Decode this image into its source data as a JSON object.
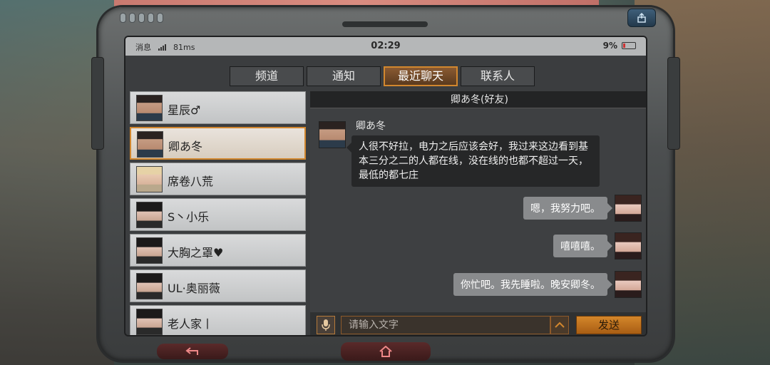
{
  "status_bar": {
    "messages_label": "消息",
    "ping": "81ms",
    "time": "02:29",
    "battery": "9%"
  },
  "tabs": [
    {
      "label": "频道",
      "active": false
    },
    {
      "label": "通知",
      "active": false
    },
    {
      "label": "最近聊天",
      "active": true
    },
    {
      "label": "联系人",
      "active": false
    }
  ],
  "contacts": [
    {
      "name": "星辰♂",
      "avatar": "male-avatar"
    },
    {
      "name": "卿あ冬",
      "avatar": "male-avatar",
      "selected": true
    },
    {
      "name": "席卷八荒",
      "avatar": "blonde-avatar"
    },
    {
      "name": "S丶小乐",
      "avatar": "female-avatar"
    },
    {
      "name": "大胸之罩♥",
      "avatar": "female-avatar"
    },
    {
      "name": "UL·奥丽薇",
      "avatar": "female-avatar"
    },
    {
      "name": "老人家丨",
      "avatar": "female-avatar"
    }
  ],
  "chat": {
    "header": "卿あ冬(好友)",
    "incoming": {
      "sender": "卿あ冬",
      "text": "人很不好拉，电力之后应该会好，我过来这边看到基本三分之二的人都在线，没在线的也都不超过一天，最低的都七庄"
    },
    "outgoing": [
      {
        "text": "嗯，我努力吧。"
      },
      {
        "text": "嘻嘻嘻。"
      },
      {
        "text": "你忙吧。我先睡啦。晚安卿冬。"
      }
    ],
    "input_placeholder": "请输入文字",
    "send_label": "发送"
  },
  "colors": {
    "accent": "#d2872e",
    "send_button": "#c47620"
  }
}
